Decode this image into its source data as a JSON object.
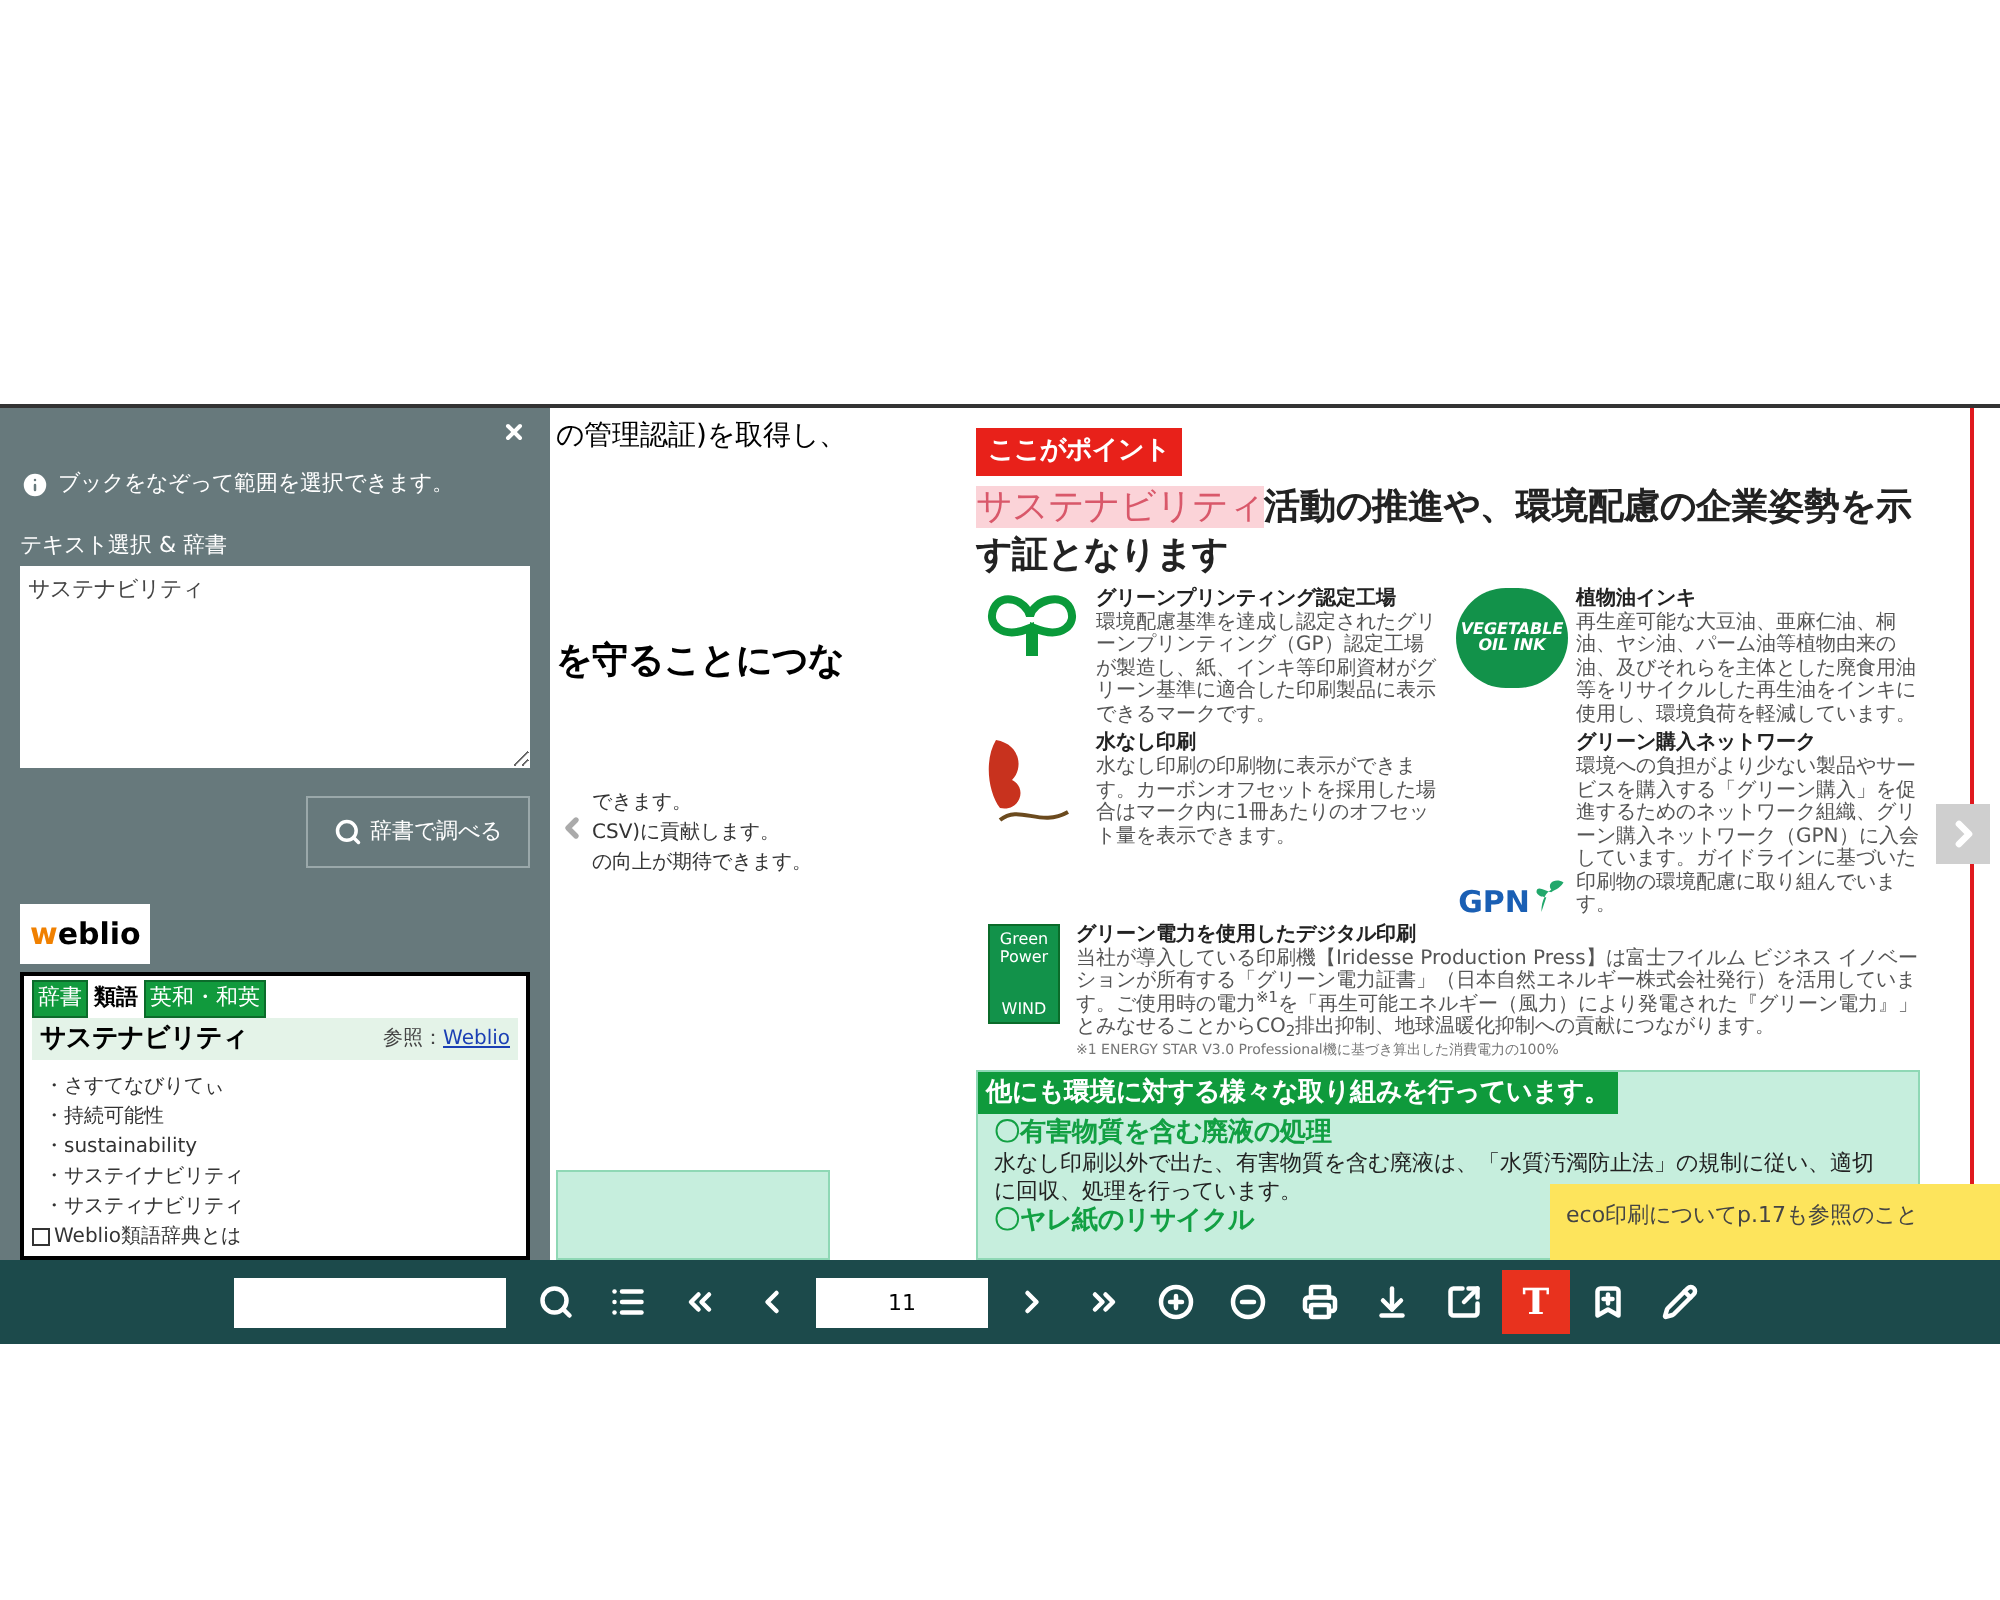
{
  "side_panel": {
    "hint": "ブックをなぞって範囲を選択できます。",
    "section_label": "テキスト選択 & 辞書",
    "selection_text": "サステナビリティ",
    "lookup_button": "辞書で調べる",
    "dictionary": {
      "logo": "weblio",
      "tabs": [
        {
          "label": "辞書",
          "selected": false
        },
        {
          "label": "類語",
          "selected": true
        },
        {
          "label": "英和・和英",
          "selected": false
        }
      ],
      "headword": "サステナビリティ",
      "reference_label": "参照：",
      "reference_link": "Weblio",
      "entries": [
        "・さすてなびりてぃ",
        "・持続可能性",
        "・sustainability",
        "・サステイナビリティ",
        "・サスティナビリティ"
      ],
      "footer_link": "Weblio類語辞典とは"
    }
  },
  "left_page": {
    "top_line": "の管理認証)を取得し、",
    "heading": "を守ることにつな",
    "body_lines": [
      "できます。",
      "CSV)に貢献します。",
      "の向上が期待できます。"
    ]
  },
  "right_page": {
    "point_label": "ここがポイント",
    "headline_highlight": "サステナビリティ",
    "headline": "活動の推進や、環境配慮の企業姿勢を示す証となります",
    "marks": [
      {
        "kind": "gp",
        "title": "グリーンプリンティング認定工場",
        "text": "環境配慮基準を達成し認定されたグリーンプリンティング（GP）認定工場が製造し、紙、インキ等印刷資材がグリーン基準に適合した印刷製品に表示できるマークです。"
      },
      {
        "kind": "vegetable",
        "logo_lines": [
          "VEGETABLE",
          "OIL INK"
        ],
        "title": "植物油インキ",
        "text": "再生産可能な大豆油、亜麻仁油、桐油、ヤシ油、パーム油等植物由来の油、及びそれらを主体とした廃食用油等をリサイクルした再生油をインキに使用し、環境負荷を軽減しています。"
      },
      {
        "kind": "waterless",
        "title": "水なし印刷",
        "text": "水なし印刷の印刷物に表示ができます。カーボンオフセットを採用した場合はマーク内に1冊あたりのオフセット量を表示できます。"
      },
      {
        "kind": "gpn",
        "logo_lines": [
          "GPN"
        ],
        "title": "グリーン購入ネットワーク",
        "text": "環境への負担がより少ない製品やサービスを購入する「グリーン購入」を促進するためのネットワーク組織、グリーン購入ネットワーク（GPN）に入会しています。ガイドラインに基づいた印刷物の環境配慮に取り組んでいます。"
      }
    ],
    "green_power": {
      "logo_lines": [
        "Green",
        "Power",
        "WIND"
      ],
      "title": "グリーン電力を使用したデジタル印刷",
      "text": "当社が導入している印刷機【Iridesse Production Press】は富士フイルム ビジネス イノベーションが所有する「グリーン電力証書」（日本自然エネルギー株式会社発行）を活用しています。ご使用時の電力$^{※1}$を「再生可能エネルギー（風力）により発電された『グリーン電力』」とみなせることからCO$_{2}$排出抑制、地球温暖化抑制への貢献につながります。",
      "footnote": "※1 ENERGY STAR V3.0 Professional機に基づき算出した消費電力の100%"
    },
    "other_efforts": {
      "title": "他にも環境に対する様々な取り組みを行っています。",
      "items": [
        {
          "heading": "〇有害物質を含む廃液の処理",
          "text": "水なし印刷以外で出た、有害物質を含む廃液は、「水質汚濁防止法」の規制に従い、適切に回収、処理を行っています。"
        },
        {
          "heading": "〇ヤレ紙のリサイクル"
        }
      ]
    }
  },
  "sticky_note": "eco印刷についてp.17も参照のこと",
  "toolbar": {
    "page": "11",
    "tools": [
      {
        "kind": "search",
        "selected": false
      },
      {
        "kind": "contents",
        "selected": false
      },
      {
        "kind": "first",
        "selected": false
      },
      {
        "kind": "prev",
        "selected": false
      },
      {
        "kind": "page"
      },
      {
        "kind": "next",
        "selected": false
      },
      {
        "kind": "last",
        "selected": false
      },
      {
        "kind": "zoom_in",
        "selected": false
      },
      {
        "kind": "zoom_out",
        "selected": false
      },
      {
        "kind": "print",
        "selected": false
      },
      {
        "kind": "download",
        "selected": false
      },
      {
        "kind": "share",
        "selected": false
      },
      {
        "kind": "text",
        "label": "T",
        "selected": true
      },
      {
        "kind": "bookmark",
        "selected": false
      },
      {
        "kind": "pen",
        "selected": false
      }
    ]
  }
}
